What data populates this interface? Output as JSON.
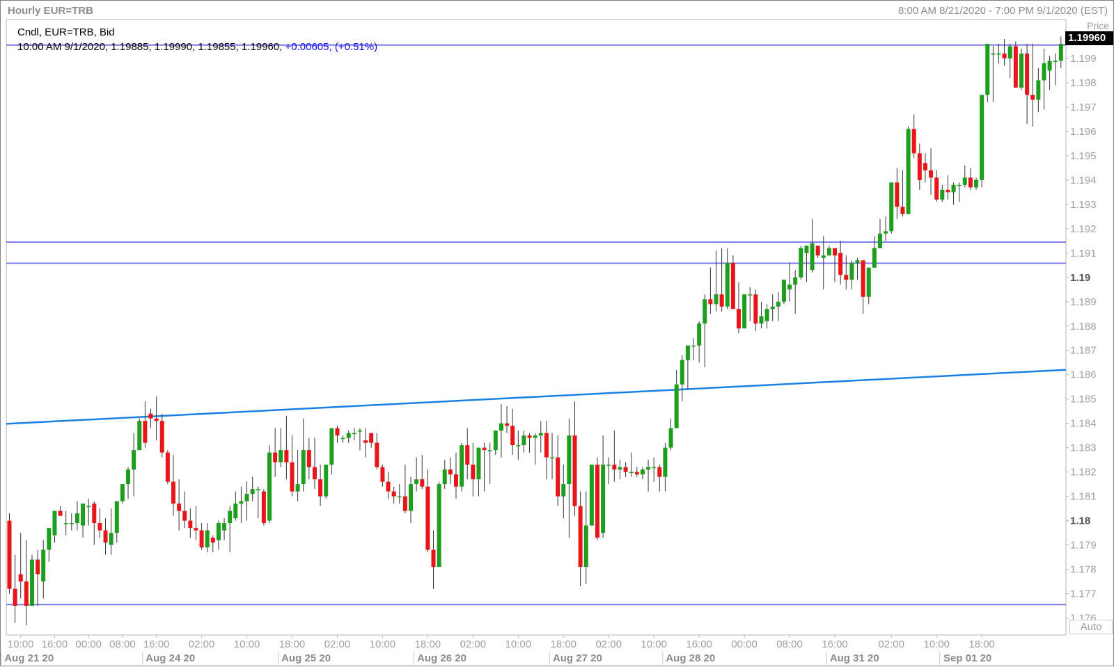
{
  "header": {
    "title": "Hourly EUR=TRB",
    "range": "8:00 AM 8/21/2020 - 7:00 PM 9/1/2020 (EST)"
  },
  "legend": {
    "line1": "Cndl, EUR=TRB, Bid",
    "ohlc": "10:00 AM 9/1/2020, 1.19885, 1.19990, 1.19855, 1.19960,",
    "change": "+0.00605, (+0.51%)"
  },
  "price_axis": {
    "label": "Price",
    "last_price": "1.19960",
    "auto_label": "Auto"
  },
  "colors": {
    "up": "#1e9e1e",
    "down": "#e8161a",
    "hline": "#7a7aee",
    "trendline": "#1a80e6",
    "grid_text": "#8c8c8c",
    "axis_text": "#a0a0a0"
  },
  "chart_data": {
    "type": "candlestick",
    "symbol": "EUR=TRB",
    "interval": "Hourly",
    "ylim": [
      1.1753,
      1.2006
    ],
    "y_ticks": [
      {
        "v": 1.199,
        "t": "1.199"
      },
      {
        "v": 1.198,
        "t": "1.198"
      },
      {
        "v": 1.197,
        "t": "1.197"
      },
      {
        "v": 1.196,
        "t": "1.196"
      },
      {
        "v": 1.195,
        "t": "1.195"
      },
      {
        "v": 1.194,
        "t": "1.194"
      },
      {
        "v": 1.193,
        "t": "1.193"
      },
      {
        "v": 1.192,
        "t": "1.192"
      },
      {
        "v": 1.191,
        "t": "1.191"
      },
      {
        "v": 1.19,
        "t": "1.19",
        "bold": true
      },
      {
        "v": 1.189,
        "t": "1.189"
      },
      {
        "v": 1.188,
        "t": "1.188"
      },
      {
        "v": 1.187,
        "t": "1.187"
      },
      {
        "v": 1.186,
        "t": "1.186"
      },
      {
        "v": 1.185,
        "t": "1.185"
      },
      {
        "v": 1.184,
        "t": "1.184"
      },
      {
        "v": 1.183,
        "t": "1.183"
      },
      {
        "v": 1.182,
        "t": "1.182"
      },
      {
        "v": 1.181,
        "t": "1.181"
      },
      {
        "v": 1.18,
        "t": "1.18",
        "bold": true
      },
      {
        "v": 1.179,
        "t": "1.179"
      },
      {
        "v": 1.178,
        "t": "1.178"
      },
      {
        "v": 1.177,
        "t": "1.177"
      },
      {
        "v": 1.176,
        "t": "1.176"
      }
    ],
    "x_time_labels": [
      {
        "i": 2,
        "t": "10:00"
      },
      {
        "i": 8,
        "t": "16:00"
      },
      {
        "i": 14,
        "t": "00:00"
      },
      {
        "i": 20,
        "t": "08:00"
      },
      {
        "i": 26,
        "t": "16:00"
      },
      {
        "i": 34,
        "t": "02:00"
      },
      {
        "i": 42,
        "t": "10:00"
      },
      {
        "i": 50,
        "t": "18:00"
      },
      {
        "i": 58,
        "t": "02:00"
      },
      {
        "i": 66,
        "t": "10:00"
      },
      {
        "i": 74,
        "t": "18:00"
      },
      {
        "i": 82,
        "t": "02:00"
      },
      {
        "i": 90,
        "t": "10:00"
      },
      {
        "i": 98,
        "t": "18:00"
      },
      {
        "i": 106,
        "t": "02:00"
      },
      {
        "i": 114,
        "t": "10:00"
      },
      {
        "i": 122,
        "t": "16:00"
      },
      {
        "i": 130,
        "t": "00:00"
      },
      {
        "i": 138,
        "t": "08:00"
      },
      {
        "i": 146,
        "t": "16:00"
      },
      {
        "i": 156,
        "t": "02:00"
      },
      {
        "i": 164,
        "t": "10:00"
      },
      {
        "i": 172,
        "t": "18:00"
      }
    ],
    "x_date_labels": [
      {
        "i": 2,
        "t": "Aug 21 20"
      },
      {
        "i": 27,
        "t": "Aug 24 20"
      },
      {
        "i": 51,
        "t": "Aug 25 20"
      },
      {
        "i": 75,
        "t": "Aug 26 20"
      },
      {
        "i": 99,
        "t": "Aug 27 20"
      },
      {
        "i": 119,
        "t": "Aug 28 20"
      },
      {
        "i": 148,
        "t": "Aug 31 20"
      },
      {
        "i": 168,
        "t": "Sep 01 20"
      }
    ],
    "horizontal_lines": [
      1.19955,
      1.19145,
      1.19058,
      1.17655
    ],
    "trendline": {
      "start": [
        0,
        1.18398
      ],
      "end": [
        180,
        1.1862
      ]
    },
    "candles": [
      [
        1.18,
        1.1803,
        1.177,
        1.1772
      ],
      [
        1.1772,
        1.1786,
        1.1758,
        1.1765
      ],
      [
        1.1778,
        1.1795,
        1.1768,
        1.1775
      ],
      [
        1.1775,
        1.1792,
        1.1757,
        1.1765
      ],
      [
        1.1765,
        1.1786,
        1.1765,
        1.1784
      ],
      [
        1.1784,
        1.1788,
        1.1765,
        1.1778
      ],
      [
        1.1775,
        1.1792,
        1.1768,
        1.1788
      ],
      [
        1.1788,
        1.1797,
        1.1783,
        1.1797
      ],
      [
        1.1794,
        1.1804,
        1.1791,
        1.1804
      ],
      [
        1.1804,
        1.1806,
        1.1802,
        1.1802
      ],
      [
        1.1799,
        1.1804,
        1.1794,
        1.1799
      ],
      [
        1.1799,
        1.1803,
        1.1796,
        1.1799
      ],
      [
        1.1799,
        1.1808,
        1.1796,
        1.1803
      ],
      [
        1.1798,
        1.1806,
        1.1793,
        1.1807
      ],
      [
        1.1806,
        1.1809,
        1.1798,
        1.1806
      ],
      [
        1.1807,
        1.1808,
        1.179,
        1.1799
      ],
      [
        1.1799,
        1.1805,
        1.1793,
        1.1796
      ],
      [
        1.1796,
        1.1801,
        1.1786,
        1.1791
      ],
      [
        1.179,
        1.1805,
        1.1786,
        1.1795
      ],
      [
        1.1795,
        1.1808,
        1.1791,
        1.1808
      ],
      [
        1.1808,
        1.1815,
        1.1807,
        1.1815
      ],
      [
        1.1815,
        1.1822,
        1.1809,
        1.1821
      ],
      [
        1.1821,
        1.1836,
        1.181,
        1.1829
      ],
      [
        1.1829,
        1.1842,
        1.1829,
        1.1841
      ],
      [
        1.1841,
        1.1849,
        1.183,
        1.1832
      ],
      [
        1.1844,
        1.1846,
        1.1838,
        1.1842
      ],
      [
        1.1842,
        1.1851,
        1.1833,
        1.1841
      ],
      [
        1.1841,
        1.1844,
        1.1826,
        1.1828
      ],
      [
        1.1828,
        1.1829,
        1.1815,
        1.1816
      ],
      [
        1.1816,
        1.1827,
        1.1802,
        1.1807
      ],
      [
        1.1807,
        1.1817,
        1.1796,
        1.1804
      ],
      [
        1.1804,
        1.1812,
        1.1797,
        1.18
      ],
      [
        1.18,
        1.1805,
        1.1793,
        1.1797
      ],
      [
        1.1797,
        1.1806,
        1.1792,
        1.1796
      ],
      [
        1.1796,
        1.1799,
        1.1788,
        1.1789
      ],
      [
        1.1789,
        1.1799,
        1.1787,
        1.1796
      ],
      [
        1.1793,
        1.1794,
        1.1787,
        1.1791
      ],
      [
        1.1792,
        1.18,
        1.1788,
        1.1799
      ],
      [
        1.1796,
        1.1801,
        1.1792,
        1.1799
      ],
      [
        1.1799,
        1.1806,
        1.1787,
        1.1804
      ],
      [
        1.1801,
        1.1812,
        1.18,
        1.1807
      ],
      [
        1.1807,
        1.1814,
        1.1799,
        1.1808
      ],
      [
        1.1808,
        1.1816,
        1.18,
        1.1811
      ],
      [
        1.1811,
        1.1818,
        1.1808,
        1.1813
      ],
      [
        1.1813,
        1.1814,
        1.1801,
        1.1813
      ],
      [
        1.1812,
        1.1813,
        1.1798,
        1.1799
      ],
      [
        1.18,
        1.1831,
        1.1799,
        1.1828
      ],
      [
        1.1828,
        1.1838,
        1.1818,
        1.1824
      ],
      [
        1.1824,
        1.1838,
        1.1822,
        1.1829
      ],
      [
        1.1829,
        1.1843,
        1.1817,
        1.1824
      ],
      [
        1.1824,
        1.1835,
        1.181,
        1.1812
      ],
      [
        1.1812,
        1.1829,
        1.1808,
        1.1815
      ],
      [
        1.1815,
        1.1842,
        1.1812,
        1.1829
      ],
      [
        1.1829,
        1.1834,
        1.1817,
        1.1822
      ],
      [
        1.1822,
        1.1834,
        1.1813,
        1.1817
      ],
      [
        1.1817,
        1.1823,
        1.1806,
        1.181
      ],
      [
        1.181,
        1.1823,
        1.1809,
        1.1823
      ],
      [
        1.1823,
        1.1838,
        1.1819,
        1.1838
      ],
      [
        1.1838,
        1.1839,
        1.1832,
        1.1835
      ],
      [
        1.1834,
        1.1835,
        1.1832,
        1.1834
      ],
      [
        1.1834,
        1.1837,
        1.1832,
        1.1836
      ],
      [
        1.1836,
        1.1838,
        1.1833,
        1.1836
      ],
      [
        1.1837,
        1.1838,
        1.1829,
        1.1837
      ],
      [
        1.1833,
        1.1838,
        1.1826,
        1.1832
      ],
      [
        1.1836,
        1.1835,
        1.183,
        1.1832
      ],
      [
        1.1832,
        1.1836,
        1.1821,
        1.1822
      ],
      [
        1.1822,
        1.1823,
        1.1814,
        1.1816
      ],
      [
        1.1816,
        1.182,
        1.1809,
        1.1812
      ],
      [
        1.1812,
        1.1814,
        1.1807,
        1.181
      ],
      [
        1.181,
        1.1815,
        1.1807,
        1.181
      ],
      [
        1.181,
        1.1823,
        1.1803,
        1.1804
      ],
      [
        1.1804,
        1.1818,
        1.1799,
        1.1815
      ],
      [
        1.1815,
        1.1826,
        1.1812,
        1.1817
      ],
      [
        1.1817,
        1.1827,
        1.1813,
        1.1814
      ],
      [
        1.1814,
        1.1821,
        1.1787,
        1.1788
      ],
      [
        1.1788,
        1.1796,
        1.1772,
        1.1781
      ],
      [
        1.1781,
        1.1816,
        1.1786,
        1.1815
      ],
      [
        1.1815,
        1.1825,
        1.1813,
        1.1821
      ],
      [
        1.1821,
        1.1826,
        1.1815,
        1.1819
      ],
      [
        1.1819,
        1.1828,
        1.1809,
        1.1814
      ],
      [
        1.1814,
        1.1832,
        1.1812,
        1.1831
      ],
      [
        1.1831,
        1.1838,
        1.1817,
        1.1823
      ],
      [
        1.1823,
        1.1832,
        1.181,
        1.1817
      ],
      [
        1.1817,
        1.1823,
        1.181,
        1.183
      ],
      [
        1.183,
        1.1832,
        1.1812,
        1.1829
      ],
      [
        1.1829,
        1.1832,
        1.1815,
        1.1829
      ],
      [
        1.1829,
        1.1837,
        1.1827,
        1.1837
      ],
      [
        1.1837,
        1.1848,
        1.1826,
        1.184
      ],
      [
        1.184,
        1.1847,
        1.1836,
        1.1839
      ],
      [
        1.1839,
        1.1846,
        1.1827,
        1.1831
      ],
      [
        1.1831,
        1.1837,
        1.1825,
        1.1831
      ],
      [
        1.1831,
        1.1837,
        1.1828,
        1.1835
      ],
      [
        1.1835,
        1.1836,
        1.1828,
        1.1834
      ],
      [
        1.1834,
        1.1836,
        1.1823,
        1.1835
      ],
      [
        1.1835,
        1.1841,
        1.1828,
        1.1836
      ],
      [
        1.1836,
        1.1841,
        1.1817,
        1.1826
      ],
      [
        1.1826,
        1.1836,
        1.1817,
        1.1826
      ],
      [
        1.1826,
        1.1835,
        1.1806,
        1.181
      ],
      [
        1.181,
        1.1823,
        1.1801,
        1.1815
      ],
      [
        1.1815,
        1.1842,
        1.1793,
        1.1835
      ],
      [
        1.1835,
        1.1849,
        1.1802,
        1.1806
      ],
      [
        1.1806,
        1.1812,
        1.1773,
        1.1781
      ],
      [
        1.1781,
        1.1812,
        1.1774,
        1.1798
      ],
      [
        1.1798,
        1.1823,
        1.1798,
        1.1823
      ],
      [
        1.1823,
        1.1826,
        1.1792,
        1.1793
      ],
      [
        1.1795,
        1.1835,
        1.1793,
        1.1823
      ],
      [
        1.1823,
        1.1826,
        1.1815,
        1.1823
      ],
      [
        1.1823,
        1.1837,
        1.1816,
        1.1821
      ],
      [
        1.1821,
        1.1825,
        1.1817,
        1.1822
      ],
      [
        1.1822,
        1.1824,
        1.1818,
        1.182
      ],
      [
        1.182,
        1.1828,
        1.1818,
        1.182
      ],
      [
        1.182,
        1.1822,
        1.1818,
        1.1819
      ],
      [
        1.1819,
        1.1822,
        1.1817,
        1.1821
      ],
      [
        1.1821,
        1.1825,
        1.1812,
        1.1822
      ],
      [
        1.1822,
        1.1826,
        1.1816,
        1.1822
      ],
      [
        1.1822,
        1.1823,
        1.1812,
        1.1818
      ],
      [
        1.1818,
        1.1832,
        1.1812,
        1.183
      ],
      [
        1.183,
        1.1842,
        1.1829,
        1.1838
      ],
      [
        1.1838,
        1.1862,
        1.1838,
        1.1856
      ],
      [
        1.1856,
        1.1868,
        1.1849,
        1.1866
      ],
      [
        1.1866,
        1.1872,
        1.1854,
        1.1872
      ],
      [
        1.1872,
        1.1875,
        1.1866,
        1.1872
      ],
      [
        1.1872,
        1.1882,
        1.1865,
        1.1881
      ],
      [
        1.1881,
        1.1893,
        1.1863,
        1.1891
      ],
      [
        1.1891,
        1.1904,
        1.1885,
        1.1889
      ],
      [
        1.1889,
        1.1911,
        1.1886,
        1.1893
      ],
      [
        1.1893,
        1.1912,
        1.1886,
        1.1888
      ],
      [
        1.1888,
        1.1912,
        1.1887,
        1.1906
      ],
      [
        1.1906,
        1.1909,
        1.1889,
        1.1887
      ],
      [
        1.1887,
        1.1898,
        1.1877,
        1.1879
      ],
      [
        1.1879,
        1.1893,
        1.1879,
        1.1893
      ],
      [
        1.1893,
        1.1896,
        1.1882,
        1.1893
      ],
      [
        1.1893,
        1.1895,
        1.1878,
        1.1881
      ],
      [
        1.1881,
        1.189,
        1.1879,
        1.1884
      ],
      [
        1.1882,
        1.1889,
        1.1879,
        1.1887
      ],
      [
        1.1887,
        1.1893,
        1.1882,
        1.1888
      ],
      [
        1.1888,
        1.1894,
        1.1882,
        1.189
      ],
      [
        1.189,
        1.1899,
        1.1889,
        1.1899
      ],
      [
        1.1895,
        1.1906,
        1.189,
        1.1897
      ],
      [
        1.1897,
        1.1903,
        1.1885,
        1.19
      ],
      [
        1.19,
        1.1913,
        1.1899,
        1.1912
      ],
      [
        1.191,
        1.1908,
        1.1898,
        1.1913
      ],
      [
        1.1903,
        1.1924,
        1.1902,
        1.1914
      ],
      [
        1.1913,
        1.1913,
        1.1908,
        1.1909
      ],
      [
        1.1908,
        1.1917,
        1.1895,
        1.1909
      ],
      [
        1.1909,
        1.1913,
        1.191,
        1.1912
      ],
      [
        1.1912,
        1.1911,
        1.1898,
        1.1909
      ],
      [
        1.191,
        1.1915,
        1.1897,
        1.1901
      ],
      [
        1.1901,
        1.1909,
        1.1895,
        1.1899
      ],
      [
        1.1899,
        1.1907,
        1.1895,
        1.1906
      ],
      [
        1.1906,
        1.1908,
        1.1899,
        1.1907
      ],
      [
        1.1907,
        1.1907,
        1.1885,
        1.1892
      ],
      [
        1.1892,
        1.1904,
        1.1889,
        1.1904
      ],
      [
        1.1904,
        1.1917,
        1.1904,
        1.1912
      ],
      [
        1.1912,
        1.1924,
        1.1913,
        1.1918
      ],
      [
        1.1918,
        1.1925,
        1.1915,
        1.1919
      ],
      [
        1.1919,
        1.1939,
        1.1918,
        1.1939
      ],
      [
        1.1939,
        1.1945,
        1.1924,
        1.1929
      ],
      [
        1.1929,
        1.1944,
        1.1925,
        1.1926
      ],
      [
        1.1926,
        1.1962,
        1.1927,
        1.1961
      ],
      [
        1.1961,
        1.1967,
        1.1949,
        1.1951
      ],
      [
        1.1951,
        1.1955,
        1.1936,
        1.194
      ],
      [
        1.1947,
        1.1951,
        1.1939,
        1.1944
      ],
      [
        1.1944,
        1.1953,
        1.1934,
        1.1941
      ],
      [
        1.1941,
        1.1944,
        1.1931,
        1.1932
      ],
      [
        1.1932,
        1.1938,
        1.1931,
        1.1936
      ],
      [
        1.1936,
        1.1942,
        1.1932,
        1.1935
      ],
      [
        1.1935,
        1.1939,
        1.193,
        1.1938
      ],
      [
        1.1938,
        1.1939,
        1.1931,
        1.1938
      ],
      [
        1.1938,
        1.1946,
        1.1937,
        1.1941
      ],
      [
        1.1941,
        1.1945,
        1.1936,
        1.1937
      ],
      [
        1.1937,
        1.1941,
        1.1936,
        1.194
      ],
      [
        1.194,
        1.1948,
        1.1937,
        1.1975
      ],
      [
        1.1975,
        1.1986,
        1.1972,
        1.1996
      ],
      [
        1.1992,
        1.1995,
        1.1972,
        1.1992
      ],
      [
        1.1992,
        1.1996,
        1.1988,
        1.1992
      ],
      [
        1.1992,
        1.1998,
        1.1987,
        1.199
      ],
      [
        1.199,
        1.1996,
        1.1982,
        1.1995
      ],
      [
        1.1995,
        1.1997,
        1.1981,
        1.1978
      ],
      [
        1.1978,
        1.1994,
        1.1977,
        1.1992
      ],
      [
        1.1992,
        1.1996,
        1.1963,
        1.1975
      ],
      [
        1.1975,
        1.1996,
        1.1962,
        1.1973
      ],
      [
        1.1973,
        1.1986,
        1.1968,
        1.1981
      ],
      [
        1.1981,
        1.1994,
        1.1969,
        1.1988
      ],
      [
        1.1985,
        1.1991,
        1.1977,
        1.1989
      ],
      [
        1.1989,
        1.1992,
        1.1979,
        1.1989
      ],
      [
        1.1989,
        1.1999,
        1.1986,
        1.1996
      ]
    ]
  }
}
